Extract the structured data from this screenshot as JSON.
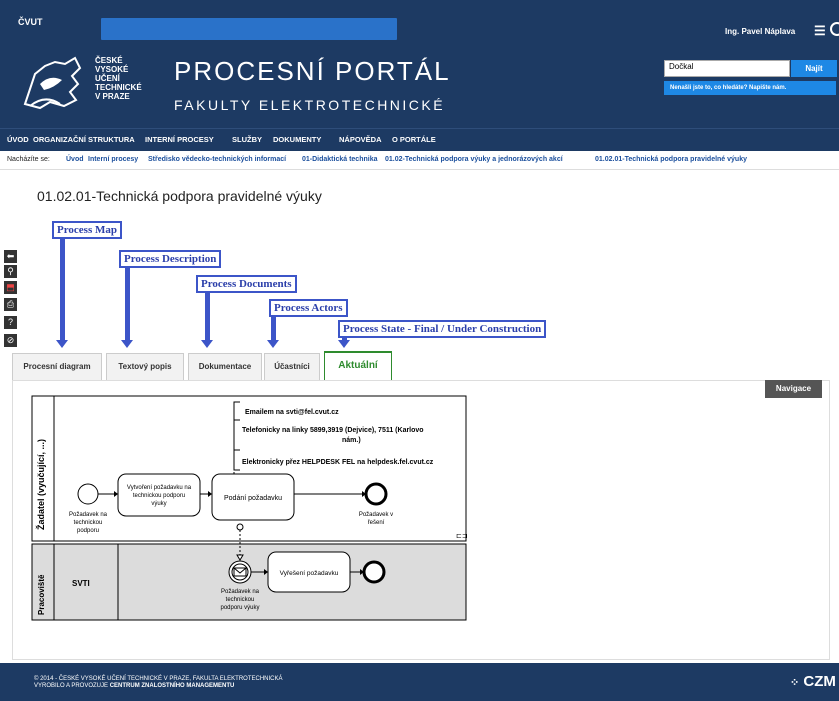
{
  "topbar": {
    "brand": "ČVUT",
    "user": "Ing. Pavel Náplava",
    "menu_icon": "hamburger-icon",
    "power_icon": "power-icon"
  },
  "header": {
    "logo_lines": [
      "ČESKÉ",
      "VYSOKÉ",
      "UČENÍ",
      "TECHNICKÉ",
      "V PRAZE"
    ],
    "title": "PROCESNÍ PORTÁL",
    "subtitle": "FAKULTY ELEKTROTECHNICKÉ",
    "search": {
      "value": "Dočkal",
      "button": "Najít",
      "hint": "Nenašli jste to, co hledáte? Napište nám."
    }
  },
  "nav": [
    "ÚVOD",
    "ORGANIZAČNÍ STRUKTURA",
    "INTERNÍ PROCESY",
    "SLUŽBY",
    "DOKUMENTY",
    "NÁPOVĚDA",
    "O PORTÁLE"
  ],
  "breadcrumb": {
    "prefix": "Nacházíte se:",
    "items": [
      "Úvod",
      "Interní procesy",
      "Středisko vědecko-technických informací",
      "01-Didaktická technika",
      "01.02-Technická podpora výuky a jednorázových akcí",
      "01.02.01-Technická podpora pravidelné výuky"
    ]
  },
  "page_title": "01.02.01-Technická podpora pravidelné výuky",
  "annotations": [
    "Process Map",
    "Process Description",
    "Process Documents",
    "Process Actors",
    "Process State - Final / Under Construction"
  ],
  "toolbar": [
    {
      "icon": "back-arrow-icon",
      "glyph": "⬅"
    },
    {
      "icon": "search-icon",
      "glyph": "⚲"
    },
    {
      "icon": "pdf-icon",
      "glyph": "⬒"
    },
    {
      "icon": "print-icon",
      "glyph": "⎙"
    },
    {
      "icon": "help-icon",
      "glyph": "?"
    },
    {
      "icon": "block-icon",
      "glyph": "⊘"
    }
  ],
  "tabs": [
    "Procesní diagram",
    "Textový popis",
    "Dokumentace",
    "Účastníci",
    "Aktuální"
  ],
  "navigation_button": "Navigace",
  "diagram": {
    "lane1": "Žadatel (vyučující, ...)",
    "lane2": "Pracoviště",
    "svti": "SVTI",
    "contact1": "Emailem na svti@fel.cvut.cz",
    "contact2a": "Telefonicky na linky 5899,3919 (Dejvice), 7511 (Karlovo",
    "contact2b": "nám.)",
    "contact3": "Elektronicky přez HELPDESK FEL na helpdesk.fel.cvut.cz",
    "start": [
      "Požadavek na",
      "technickou",
      "podporu"
    ],
    "task1": [
      "Vytvoření požadavku na",
      "technickou podporu",
      "výuky"
    ],
    "task2": "Podání požadavku",
    "end1": [
      "Požadavek v",
      "řešení"
    ],
    "msg": [
      "Požadavek na",
      "technickou",
      "podporu výuky"
    ],
    "task3": "Vyřešení požadavku"
  },
  "footer": {
    "line1": "© 2014 - ČESKÉ VYSOKÉ UČENÍ TECHNICKÉ V PRAZE, FAKULTA ELEKTROTECHNICKÁ",
    "line2_prefix": "VYROBILO A PROVOZUJE",
    "line2_org": "CENTRUM ZNALOSTNÍHO MANAGEMENTU",
    "czm": "CZM"
  }
}
